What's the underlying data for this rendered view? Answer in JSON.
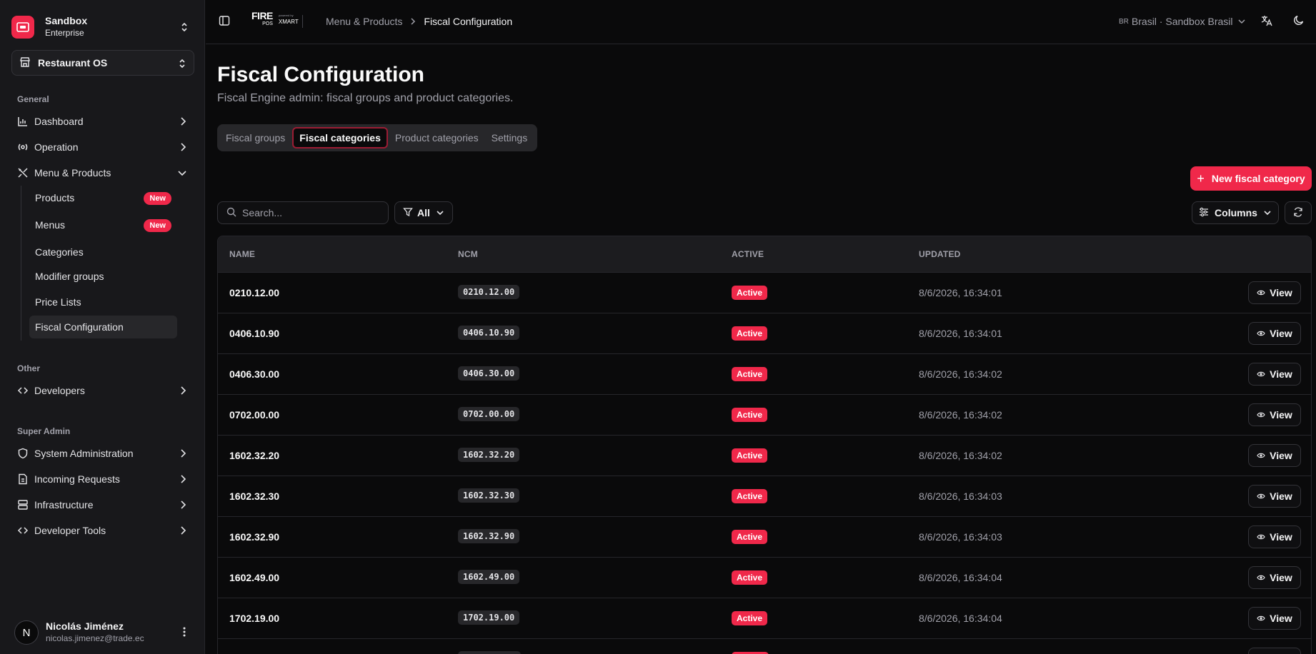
{
  "sidebar": {
    "org": {
      "name": "Sandbox",
      "plan": "Enterprise"
    },
    "app": {
      "name": "Restaurant OS"
    },
    "sections": {
      "general": "General",
      "other": "Other",
      "super_admin": "Super Admin"
    },
    "general_items": [
      {
        "label": "Dashboard",
        "icon": "chart-icon"
      },
      {
        "label": "Operation",
        "icon": "radio-icon"
      },
      {
        "label": "Menu & Products",
        "icon": "utensils-icon"
      }
    ],
    "menu_children": [
      {
        "label": "Products",
        "badge": "New"
      },
      {
        "label": "Menus",
        "badge": "New"
      },
      {
        "label": "Categories",
        "badge": ""
      },
      {
        "label": "Modifier groups",
        "badge": ""
      },
      {
        "label": "Price Lists",
        "badge": ""
      },
      {
        "label": "Fiscal Configuration",
        "badge": ""
      }
    ],
    "other_items": [
      {
        "label": "Developers",
        "icon": "code-icon"
      }
    ],
    "admin_items": [
      {
        "label": "System Administration",
        "icon": "shield-icon"
      },
      {
        "label": "Incoming Requests",
        "icon": "file-icon"
      },
      {
        "label": "Infrastructure",
        "icon": "server-icon"
      },
      {
        "label": "Developer Tools",
        "icon": "code-icon"
      }
    ],
    "user": {
      "initial": "N",
      "name": "Nicolás Jiménez",
      "email": "nicolas.jimenez@trade.ec"
    }
  },
  "topbar": {
    "logo": {
      "fire": "FIRE",
      "pos": "POS",
      "powered": "powered by",
      "xmart": "XMART"
    },
    "breadcrumb": [
      "Menu & Products",
      "Fiscal Configuration"
    ],
    "region_flag": "BR",
    "region": "Brasil · Sandbox Brasil"
  },
  "page": {
    "title": "Fiscal Configuration",
    "subtitle": "Fiscal Engine admin: fiscal groups and product categories.",
    "tabs": [
      "Fiscal groups",
      "Fiscal categories",
      "Product categories",
      "Settings"
    ],
    "active_tab": "Fiscal categories",
    "new_button": "New fiscal category",
    "search_placeholder": "Search...",
    "filter_label": "All",
    "columns_label": "Columns"
  },
  "table": {
    "headers": [
      "NAME",
      "NCM",
      "ACTIVE",
      "UPDATED"
    ],
    "view_label": "View",
    "rows": [
      {
        "name": "0210.12.00",
        "ncm": "0210.12.00",
        "active": "Active",
        "updated": "8/6/2026, 16:34:01"
      },
      {
        "name": "0406.10.90",
        "ncm": "0406.10.90",
        "active": "Active",
        "updated": "8/6/2026, 16:34:01"
      },
      {
        "name": "0406.30.00",
        "ncm": "0406.30.00",
        "active": "Active",
        "updated": "8/6/2026, 16:34:02"
      },
      {
        "name": "0702.00.00",
        "ncm": "0702.00.00",
        "active": "Active",
        "updated": "8/6/2026, 16:34:02"
      },
      {
        "name": "1602.32.20",
        "ncm": "1602.32.20",
        "active": "Active",
        "updated": "8/6/2026, 16:34:02"
      },
      {
        "name": "1602.32.30",
        "ncm": "1602.32.30",
        "active": "Active",
        "updated": "8/6/2026, 16:34:03"
      },
      {
        "name": "1602.32.90",
        "ncm": "1602.32.90",
        "active": "Active",
        "updated": "8/6/2026, 16:34:03"
      },
      {
        "name": "1602.49.00",
        "ncm": "1602.49.00",
        "active": "Active",
        "updated": "8/6/2026, 16:34:04"
      },
      {
        "name": "1702.19.00",
        "ncm": "1702.19.00",
        "active": "Active",
        "updated": "8/6/2026, 16:34:04"
      },
      {
        "name": "",
        "ncm": "",
        "active": "",
        "updated": ""
      }
    ]
  },
  "colors": {
    "accent": "#f0284a",
    "background": "#0a0a0b",
    "sidebar": "#18181b"
  }
}
